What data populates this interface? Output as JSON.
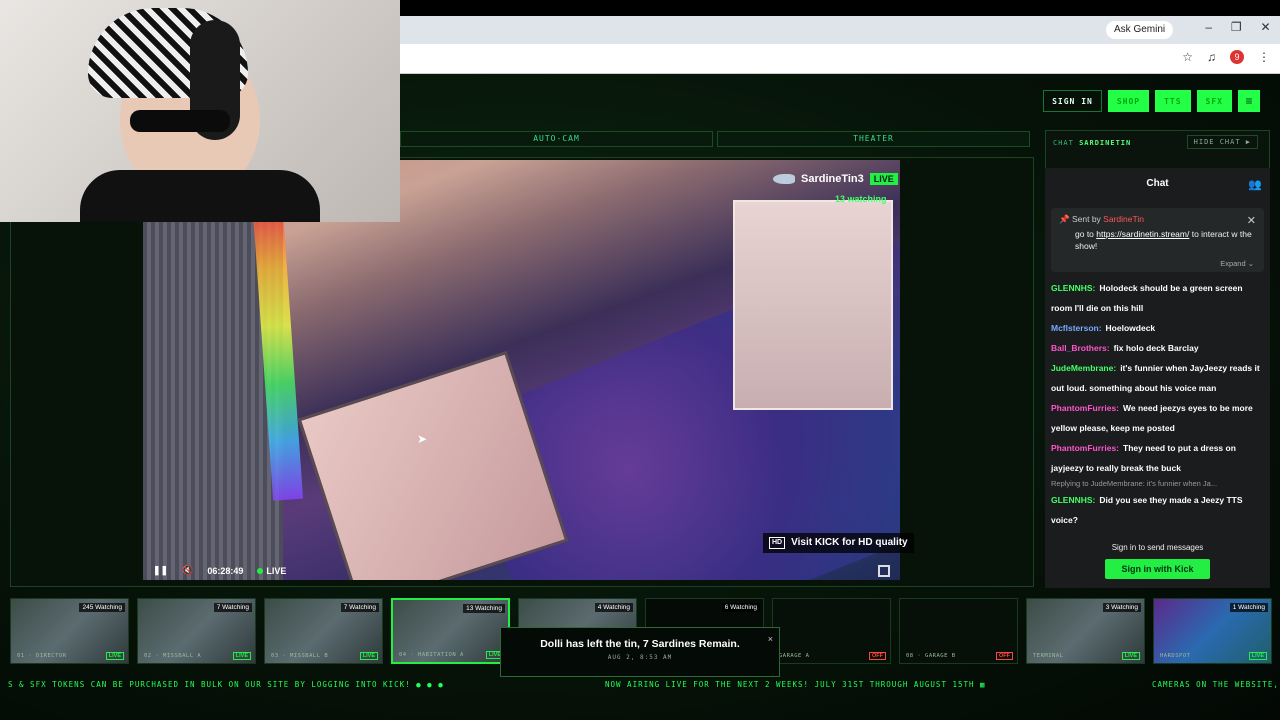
{
  "browser": {
    "ask_gemini": "Ask Gemini",
    "profile_count": "9"
  },
  "nav": {
    "sign_in": "SIGN IN",
    "shop": "SHOP",
    "tts": "TTS",
    "sfx": "SFX",
    "menu_icon": "≡"
  },
  "cam_tabs": [
    "AUTO-CAM",
    "THEATER"
  ],
  "player": {
    "streamer": "SardineTin3",
    "live_label": "LIVE",
    "watching": "13 watching",
    "hd_label": "HD",
    "hd_text": "Visit KICK for HD quality",
    "time": "06:28:49",
    "live_text": "LIVE"
  },
  "chat": {
    "label": "CHAT",
    "channel": "SARDINETIN",
    "hide": "HIDE CHAT ▶",
    "title": "Chat",
    "pinned": {
      "sent_by": "Sent by",
      "sender": "SardineTin",
      "text_before": "go to ",
      "link": "https://sardinetin.stream/",
      "text_after": " to interact w the show!",
      "expand": "Expand ⌄"
    },
    "messages": [
      {
        "user": "GLENNHS:",
        "color": "green",
        "text": "Holodeck should be a green screen room I'll die on this hill"
      },
      {
        "user": "Mcflsterson:",
        "color": "blue",
        "text": "Hoelowdeck"
      },
      {
        "user": "Ball_Brothers:",
        "color": "pink",
        "text": "fix holo deck Barclay"
      },
      {
        "user": "JudeMembrane:",
        "color": "green",
        "text": "it's funnier when JayJeezy reads it out loud. something about his voice man"
      },
      {
        "user": "PhantomFurries:",
        "color": "pink",
        "text": "We need jeezys eyes to be more yellow please, keep me posted"
      },
      {
        "user": "PhantomFurries:",
        "color": "pink",
        "text": "They need to put a dress on jayjeezy to really break the buck"
      },
      {
        "user": "GLENNHS:",
        "color": "green",
        "text": "Did you see they made a Jeezy TTS voice?",
        "reply": "Replying to JudeMembrane: it's funnier when Ja..."
      }
    ],
    "signin_text": "Sign in to send messages",
    "kick_button": "Sign in with Kick"
  },
  "thumbnails": [
    {
      "count": "245 Watching",
      "name": "01 · DIRECTOR",
      "status": "LIVE"
    },
    {
      "count": "7 Watching",
      "name": "02 · MISSBALL A",
      "status": "LIVE"
    },
    {
      "count": "7 Watching",
      "name": "03 · MISSBALL B",
      "status": "LIVE"
    },
    {
      "count": "13 Watching",
      "name": "04 · HABITATION A",
      "status": "LIVE"
    },
    {
      "count": "4 Watching",
      "name": "",
      "status": ""
    },
    {
      "count": "6 Watching",
      "name": "",
      "status": ""
    },
    {
      "count": "",
      "name": "GARAGE A",
      "status": "OFF"
    },
    {
      "count": "",
      "name": "08 · GARAGE B",
      "status": "OFF"
    },
    {
      "count": "3 Watching",
      "name": "TERMINAL",
      "status": "LIVE"
    },
    {
      "count": "1 Watching",
      "name": "HARDSPOT",
      "status": "LIVE"
    }
  ],
  "toast": {
    "title": "Dolli has left the tin, 7 Sardines Remain.",
    "time": "AUG 2, 8:53 AM",
    "close": "×"
  },
  "ticker": {
    "left": "S & SFX TOKENS CAN BE PURCHASED IN BULK ON OUR SITE BY LOGGING INTO KICK! ● ● ●",
    "middle": "NOW AIRING LIVE FOR THE NEXT 2 WEEKS! JULY 31ST THROUGH AUGUST 15TH ▦",
    "right": "CAMERAS ON THE WEBSITE, IN"
  }
}
